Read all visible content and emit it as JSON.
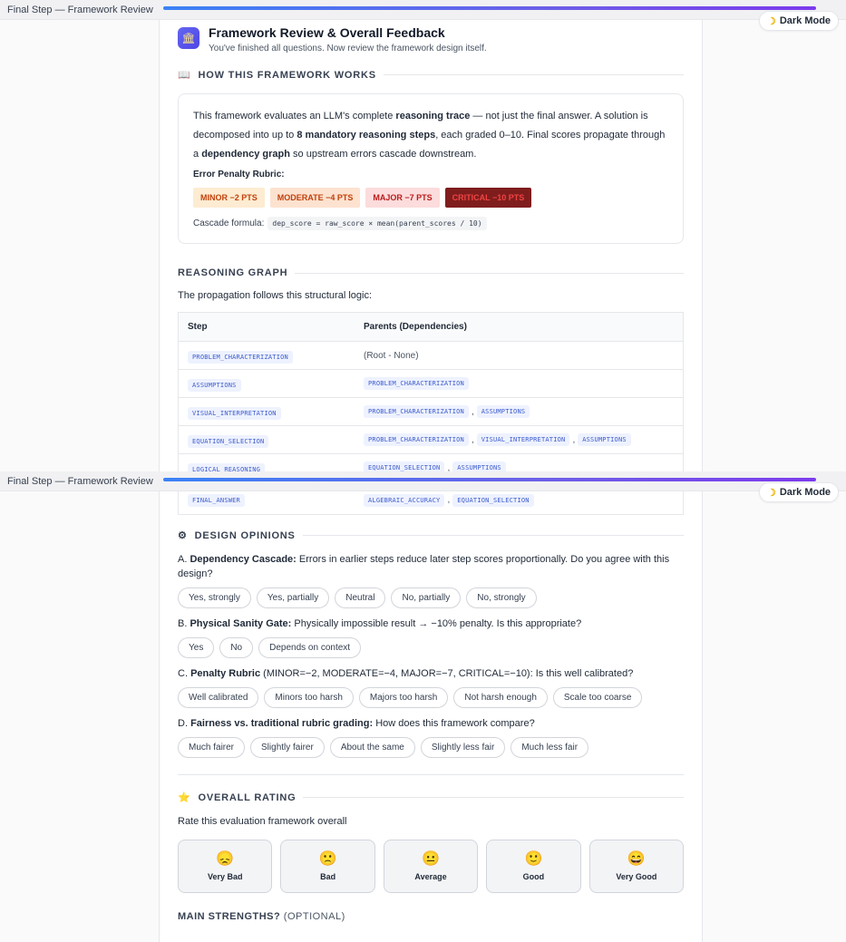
{
  "topbar": {
    "crumb": "Final Step — Framework Review",
    "dark_mode": "Dark Mode",
    "moon_icon": "☽"
  },
  "header": {
    "icon": "🏛",
    "title": "Framework Review & Overall Feedback",
    "subtitle": "You've finished all questions. Now review the framework design itself."
  },
  "how": {
    "section_icon": "📖",
    "section": "HOW THIS FRAMEWORK WORKS",
    "p1": "This framework evaluates an LLM's complete ",
    "b1": "reasoning trace",
    "p2": " — not just the final answer. A solution is decomposed into up to ",
    "b2": "8 mandatory reasoning steps",
    "p3": ", each graded 0–10. Final scores propagate through a ",
    "b3": "dependency graph",
    "p4": " so upstream errors cascade downstream.",
    "rubric_title": "Error Penalty Rubric:",
    "pills": [
      {
        "label": "MINOR −2 PTS",
        "bg": "#fdecd2",
        "fg": "#c2410c"
      },
      {
        "label": "MODERATE −4 PTS",
        "bg": "#fde2d0",
        "fg": "#c2410c"
      },
      {
        "label": "MAJOR −7 PTS",
        "bg": "#fcdcdc",
        "fg": "#b91c1c"
      },
      {
        "label": "CRITICAL −10 PTS",
        "bg": "#7f1d1d",
        "fg": "#ef4444"
      }
    ],
    "cascade_label": "Cascade formula:",
    "cascade_code": "dep_score = raw_score × mean(parent_scores / 10)"
  },
  "graph": {
    "section": "REASONING GRAPH",
    "intro": "The propagation follows this structural logic:",
    "col_step": "Step",
    "col_parents": "Parents (Dependencies)",
    "rows": [
      {
        "step": "PROBLEM_CHARACTERIZATION",
        "root": "(Root - None)"
      },
      {
        "step": "ASSUMPTIONS",
        "p1": "PROBLEM_CHARACTERIZATION"
      },
      {
        "step": "VISUAL_INTERPRETATION",
        "p1": "PROBLEM_CHARACTERIZATION",
        "p2": "ASSUMPTIONS"
      },
      {
        "step": "EQUATION_SELECTION",
        "p1": "PROBLEM_CHARACTERIZATION",
        "p2": "VISUAL_INTERPRETATION",
        "p3": "ASSUMPTIONS"
      },
      {
        "step": "LOGICAL_REASONING",
        "p1": "EQUATION_SELECTION",
        "p2": "ASSUMPTIONS"
      },
      {
        "step": "FINAL_ANSWER",
        "p1": "ALGEBRAIC_ACCURACY",
        "p2": "EQUATION_SELECTION"
      }
    ]
  },
  "opinions": {
    "section_icon": "⚙",
    "section": "DESIGN OPINIONS",
    "qa_bold": "Dependency Cascade:",
    "qa_text": " Errors in earlier steps reduce later step scores proportionally. Do you agree with this design?",
    "qa_prefix": "A. ",
    "qa_opts": [
      "Yes, strongly",
      "Yes, partially",
      "Neutral",
      "No, partially",
      "No, strongly"
    ],
    "qb_prefix": "B. ",
    "qb_bold": "Physical Sanity Gate:",
    "qb_text": " Physically impossible result → −10% penalty. Is this appropriate?",
    "qb_opts": [
      "Yes",
      "No",
      "Depends on context"
    ],
    "qc_prefix": "C. ",
    "qc_bold": "Penalty Rubric",
    "qc_text": " (MINOR=−2, MODERATE=−4, MAJOR=−7, CRITICAL=−10): Is this well calibrated?",
    "qc_opts": [
      "Well calibrated",
      "Minors too harsh",
      "Majors too harsh",
      "Not harsh enough",
      "Scale too coarse"
    ],
    "qd_prefix": "D. ",
    "qd_bold": "Fairness vs. traditional rubric grading:",
    "qd_text": " How does this framework compare?",
    "qd_opts": [
      "Much fairer",
      "Slightly fairer",
      "About the same",
      "Slightly less fair",
      "Much less fair"
    ]
  },
  "rating": {
    "section_icon": "⭐",
    "section": "OVERALL RATING",
    "prompt": "Rate this evaluation framework overall",
    "items": [
      {
        "emoji": "😞",
        "label": "Very Bad"
      },
      {
        "emoji": "🙁",
        "label": "Bad"
      },
      {
        "emoji": "😐",
        "label": "Average"
      },
      {
        "emoji": "🙂",
        "label": "Good"
      },
      {
        "emoji": "😄",
        "label": "Very Good"
      }
    ]
  },
  "strengths": {
    "label": "MAIN STRENGTHS?",
    "optional": " (OPTIONAL)"
  }
}
